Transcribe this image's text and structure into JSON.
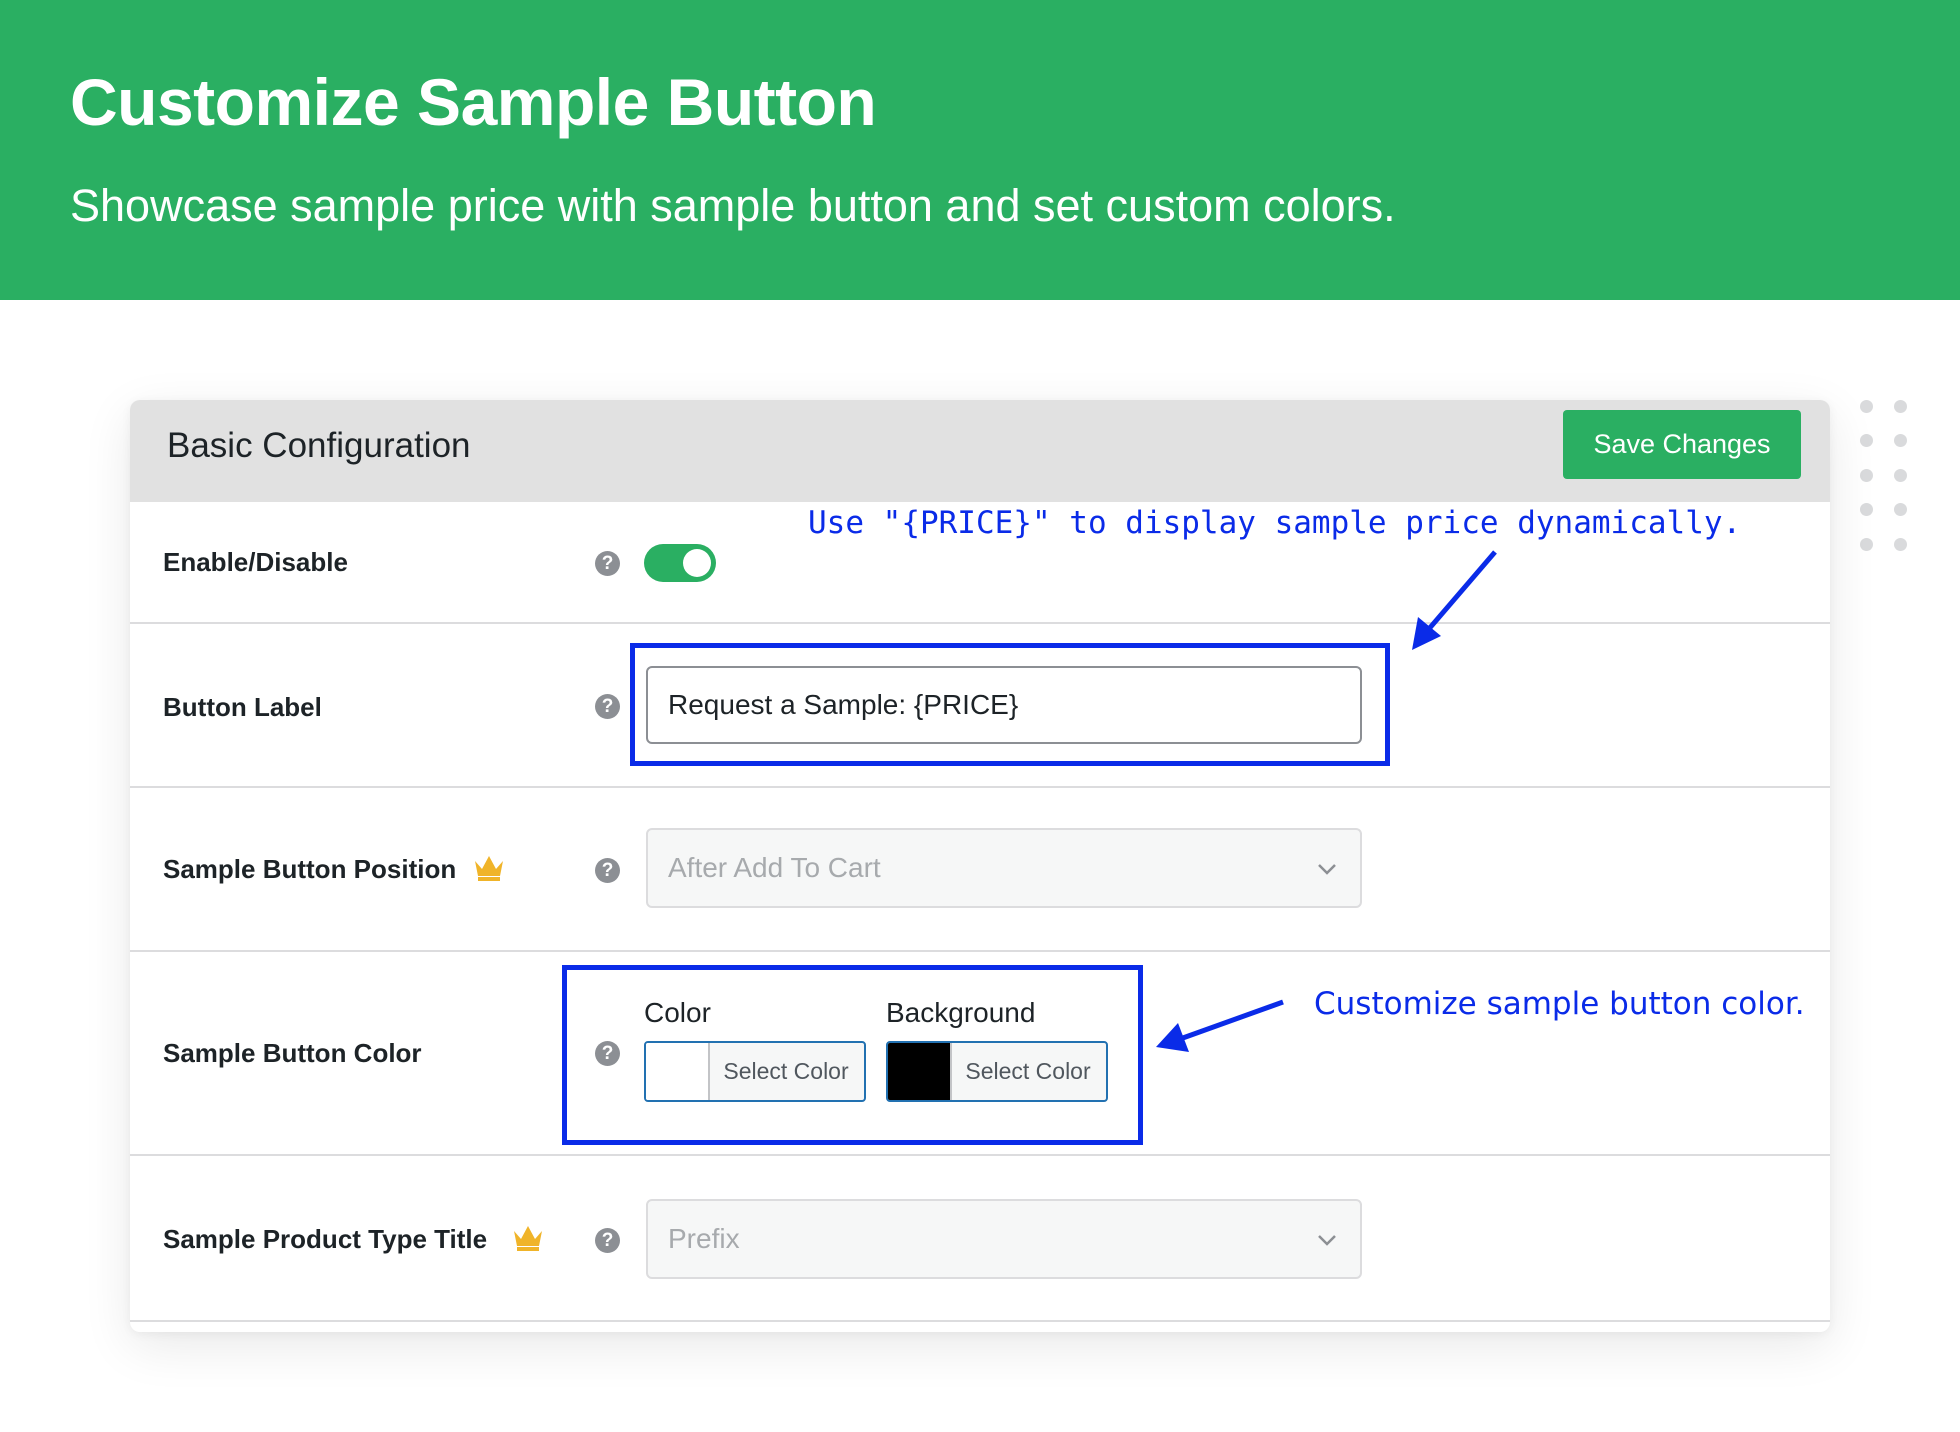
{
  "banner": {
    "title": "Customize Sample Button",
    "subtitle": "Showcase sample price with sample button and set custom colors."
  },
  "card": {
    "title": "Basic Configuration",
    "save_label": "Save Changes"
  },
  "rows": {
    "enable": {
      "label": "Enable/Disable",
      "enabled": true
    },
    "button_label": {
      "label": "Button Label",
      "value": "Request a Sample: {PRICE}"
    },
    "position": {
      "label": "Sample Button Position",
      "premium": true,
      "value": "After Add To Cart"
    },
    "color": {
      "label": "Sample Button Color",
      "color_label": "Color",
      "background_label": "Background",
      "color_value": "#ffffff",
      "background_value": "#000000",
      "select_label": "Select Color"
    },
    "type_title": {
      "label": "Sample Product Type Title",
      "premium": true,
      "value": "Prefix"
    }
  },
  "help_glyph": "?",
  "annotations": {
    "price_hint": "Use \"{PRICE}\" to display sample price dynamically.",
    "color_hint": "Customize sample button color."
  },
  "colors": {
    "brand_green": "#2aaf62",
    "annotation_blue": "#0a2be8",
    "crown_gold": "#f0b429"
  }
}
